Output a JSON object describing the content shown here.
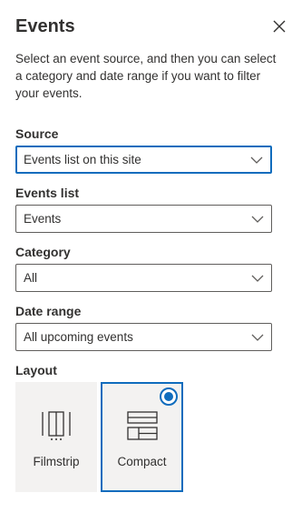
{
  "panel": {
    "title": "Events",
    "description": "Select an event source, and then you can select a category and date range if you want to filter your events."
  },
  "source": {
    "label": "Source",
    "value": "Events list on this site"
  },
  "events_list": {
    "label": "Events list",
    "value": "Events"
  },
  "category": {
    "label": "Category",
    "value": "All"
  },
  "date_range": {
    "label": "Date range",
    "value": "All upcoming events"
  },
  "layout": {
    "label": "Layout",
    "options": [
      {
        "label": "Filmstrip",
        "icon": "filmstrip-icon",
        "selected": false
      },
      {
        "label": "Compact",
        "icon": "compact-icon",
        "selected": true
      }
    ]
  },
  "icons": {
    "close": "close-icon",
    "dropdown": "chevron-down-icon",
    "radio": "radio-selected-icon"
  },
  "colors": {
    "accent": "#0f6cbd",
    "tile_background": "#f3f2f1",
    "text": "#323130"
  }
}
